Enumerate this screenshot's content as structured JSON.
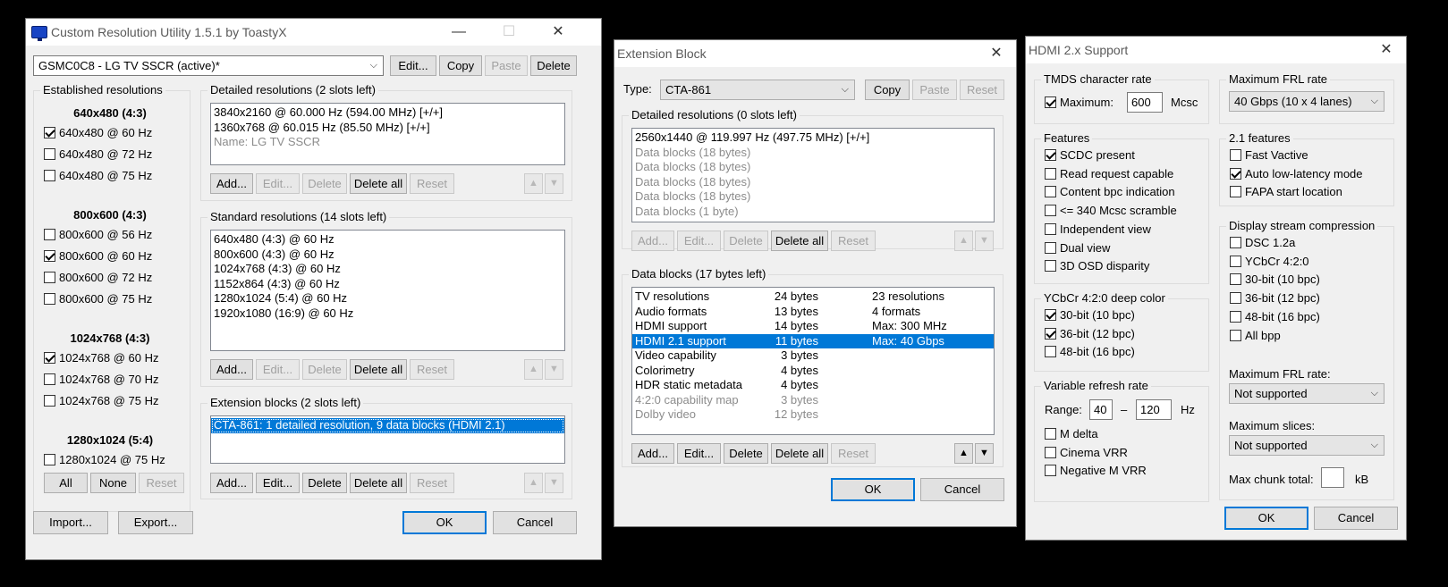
{
  "cru": {
    "title": "Custom Resolution Utility 1.5.1 by ToastyX",
    "device": "GSMC0C8 - LG TV SSCR (active)*",
    "edit_label": "Edit...",
    "copy_label": "Copy",
    "paste_label": "Paste",
    "delete_label": "Delete",
    "established": {
      "title": "Established resolutions",
      "groups": [
        {
          "header": "640x480 (4:3)",
          "items": [
            {
              "label": "640x480 @ 60 Hz",
              "checked": true
            },
            {
              "label": "640x480 @ 72 Hz",
              "checked": false
            },
            {
              "label": "640x480 @ 75 Hz",
              "checked": false
            }
          ]
        },
        {
          "header": "800x600 (4:3)",
          "items": [
            {
              "label": "800x600 @ 56 Hz",
              "checked": false
            },
            {
              "label": "800x600 @ 60 Hz",
              "checked": true
            },
            {
              "label": "800x600 @ 72 Hz",
              "checked": false
            },
            {
              "label": "800x600 @ 75 Hz",
              "checked": false
            }
          ]
        },
        {
          "header": "1024x768 (4:3)",
          "items": [
            {
              "label": "1024x768 @ 60 Hz",
              "checked": true
            },
            {
              "label": "1024x768 @ 70 Hz",
              "checked": false
            },
            {
              "label": "1024x768 @ 75 Hz",
              "checked": false
            }
          ]
        },
        {
          "header": "1280x1024 (5:4)",
          "items": [
            {
              "label": "1280x1024 @ 75 Hz",
              "checked": false
            }
          ]
        }
      ],
      "all_label": "All",
      "none_label": "None",
      "reset_label": "Reset"
    },
    "detailed": {
      "title": "Detailed resolutions (2 slots left)",
      "items": [
        {
          "text": "3840x2160 @ 60.000 Hz (594.00 MHz) [+/+]",
          "gray": false
        },
        {
          "text": "1360x768 @ 60.015 Hz (85.50 MHz) [+/+]",
          "gray": false
        },
        {
          "text": "Name: LG TV SSCR",
          "gray": true
        }
      ]
    },
    "standard": {
      "title": "Standard resolutions (14 slots left)",
      "items": [
        "640x480 (4:3) @ 60 Hz",
        "800x600 (4:3) @ 60 Hz",
        "1024x768 (4:3) @ 60 Hz",
        "1152x864 (4:3) @ 60 Hz",
        "1280x1024 (5:4) @ 60 Hz",
        "1920x1080 (16:9) @ 60 Hz"
      ]
    },
    "extension": {
      "title": "Extension blocks (2 slots left)",
      "items": [
        "CTA-861: 1 detailed resolution, 9 data blocks (HDMI 2.1)"
      ]
    },
    "list_buttons": {
      "add": "Add...",
      "edit": "Edit...",
      "delete": "Delete",
      "delete_all": "Delete all",
      "reset": "Reset"
    },
    "import_label": "Import...",
    "export_label": "Export...",
    "ok_label": "OK",
    "cancel_label": "Cancel"
  },
  "ext": {
    "title": "Extension Block",
    "type_label": "Type:",
    "type_value": "CTA-861",
    "copy_label": "Copy",
    "paste_label": "Paste",
    "reset_label": "Reset",
    "detailed": {
      "title": "Detailed resolutions (0 slots left)",
      "items": [
        {
          "text": "2560x1440 @ 119.997 Hz (497.75 MHz) [+/+]",
          "gray": false
        },
        {
          "text": "Data blocks (18 bytes)",
          "gray": true
        },
        {
          "text": "Data blocks (18 bytes)",
          "gray": true
        },
        {
          "text": "Data blocks (18 bytes)",
          "gray": true
        },
        {
          "text": "Data blocks (18 bytes)",
          "gray": true
        },
        {
          "text": "Data blocks (1 byte)",
          "gray": true
        }
      ]
    },
    "datablocks": {
      "title": "Data blocks (17 bytes left)",
      "rows": [
        {
          "name": "TV resolutions",
          "size": "24 bytes",
          "info": "23 resolutions",
          "gray": false,
          "selected": false
        },
        {
          "name": "Audio formats",
          "size": "13 bytes",
          "info": "4 formats",
          "gray": false,
          "selected": false
        },
        {
          "name": "HDMI support",
          "size": "14 bytes",
          "info": "Max: 300 MHz",
          "gray": false,
          "selected": false
        },
        {
          "name": "HDMI 2.1 support",
          "size": "11 bytes",
          "info": "Max: 40 Gbps",
          "gray": false,
          "selected": true
        },
        {
          "name": "Video capability",
          "size": "3 bytes",
          "info": "",
          "gray": false,
          "selected": false
        },
        {
          "name": "Colorimetry",
          "size": "4 bytes",
          "info": "",
          "gray": false,
          "selected": false
        },
        {
          "name": "HDR static metadata",
          "size": "4 bytes",
          "info": "",
          "gray": false,
          "selected": false
        },
        {
          "name": "4:2:0 capability map",
          "size": "3 bytes",
          "info": "",
          "gray": true,
          "selected": false
        },
        {
          "name": "Dolby video",
          "size": "12 bytes",
          "info": "",
          "gray": true,
          "selected": false
        }
      ]
    },
    "list_buttons": {
      "add": "Add...",
      "edit": "Edit...",
      "delete": "Delete",
      "delete_all": "Delete all",
      "reset": "Reset"
    },
    "ok_label": "OK",
    "cancel_label": "Cancel"
  },
  "hdmi": {
    "title": "HDMI 2.x Support",
    "tmds": {
      "title": "TMDS character rate",
      "max_label": "Maximum:",
      "max_checked": true,
      "value": "600",
      "unit": "Mcsc"
    },
    "features": {
      "title": "Features",
      "items": [
        {
          "label": "SCDC present",
          "checked": true
        },
        {
          "label": "Read request capable",
          "checked": false
        },
        {
          "label": "Content bpc indication",
          "checked": false
        },
        {
          "label": "<= 340 Mcsc scramble",
          "checked": false
        },
        {
          "label": "Independent view",
          "checked": false
        },
        {
          "label": "Dual view",
          "checked": false
        },
        {
          "label": "3D OSD disparity",
          "checked": false
        }
      ]
    },
    "ycbcr": {
      "title": "YCbCr 4:2:0 deep color",
      "items": [
        {
          "label": "30-bit (10 bpc)",
          "checked": true
        },
        {
          "label": "36-bit (12 bpc)",
          "checked": true
        },
        {
          "label": "48-bit (16 bpc)",
          "checked": false
        }
      ]
    },
    "vrr": {
      "title": "Variable refresh rate",
      "range_label": "Range:",
      "min": "40",
      "dash": "–",
      "max": "120",
      "unit": "Hz",
      "items": [
        {
          "label": "M delta",
          "checked": false
        },
        {
          "label": "Cinema VRR",
          "checked": false
        },
        {
          "label": "Negative M VRR",
          "checked": false
        }
      ]
    },
    "frl": {
      "title": "Maximum FRL rate",
      "value": "40 Gbps (10 x 4 lanes)"
    },
    "f21": {
      "title": "2.1 features",
      "items": [
        {
          "label": "Fast Vactive",
          "checked": false
        },
        {
          "label": "Auto low-latency mode",
          "checked": true
        },
        {
          "label": "FAPA start location",
          "checked": false
        }
      ]
    },
    "dsc": {
      "title": "Display stream compression",
      "items": [
        {
          "label": "DSC 1.2a",
          "checked": false
        },
        {
          "label": "YCbCr 4:2:0",
          "checked": false
        },
        {
          "label": "30-bit (10 bpc)",
          "checked": false
        },
        {
          "label": "36-bit (12 bpc)",
          "checked": false
        },
        {
          "label": "48-bit (16 bpc)",
          "checked": false
        },
        {
          "label": "All bpp",
          "checked": false
        }
      ],
      "frl_label": "Maximum FRL rate:",
      "frl_value": "Not supported",
      "slices_label": "Maximum slices:",
      "slices_value": "Not supported",
      "chunk_label": "Max chunk total:",
      "chunk_value": "",
      "chunk_unit": "kB"
    },
    "ok_label": "OK",
    "cancel_label": "Cancel"
  }
}
